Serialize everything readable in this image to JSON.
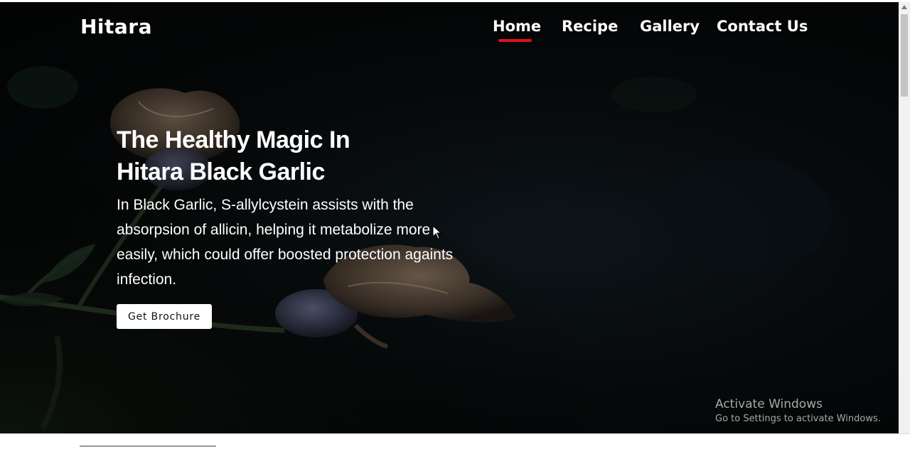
{
  "brand": {
    "logo_text": "Hitara"
  },
  "nav": {
    "items": [
      {
        "label": "Home"
      },
      {
        "label": "Recipe"
      },
      {
        "label": "Gallery"
      },
      {
        "label": "Contact Us"
      }
    ],
    "active_item": "Home"
  },
  "hero": {
    "title_line1": "The Healthy Magic In",
    "title_line2": "Hitara Black Garlic",
    "description": "In Black Garlic, S-allylcystein assists with the absorpsion of allicin, helping it metabolize more easily, which could offer boosted protection againts infection.",
    "button_label": "Get Brochure"
  },
  "os_watermark": {
    "title": "Activate Windows",
    "subtitle": "Go to Settings to activate Windows."
  },
  "icons": {
    "pointer": "mouse-pointer-icon",
    "scroll_up": "chevron-up-icon",
    "background": "dried-flower-image"
  },
  "colors": {
    "hero_bg": "#050708",
    "text": "#ffffff",
    "active_underline": "#e0121a",
    "button_bg": "#ffffff",
    "watermark_text": "#a9a9a9"
  }
}
